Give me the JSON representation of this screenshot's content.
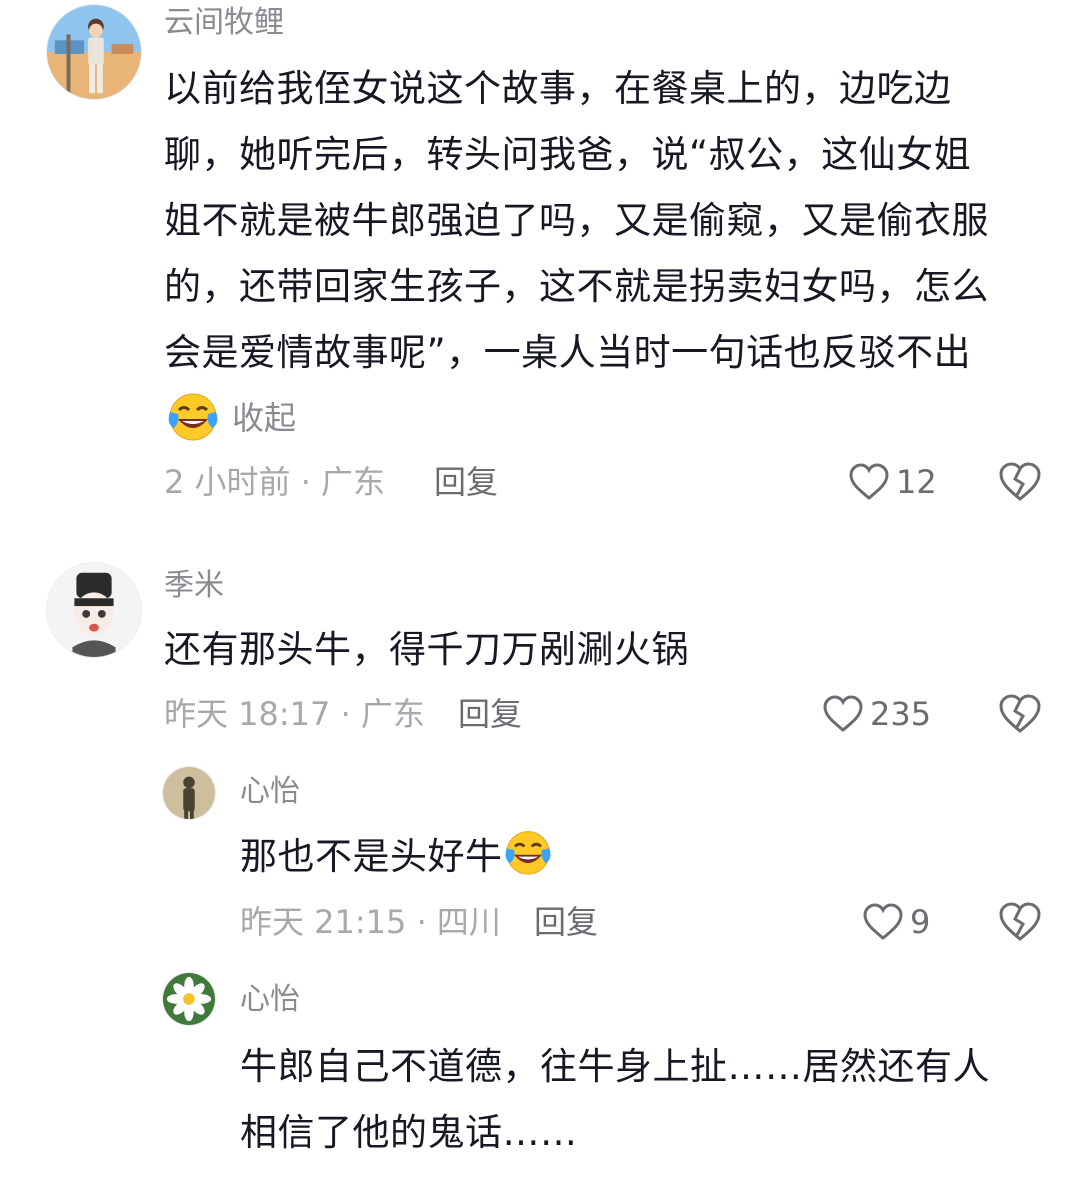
{
  "comments": [
    {
      "username": "云间牧鲤",
      "avatar_icon": "beach-person-avatar",
      "text_lines": [
        "以前给我侄女说这个故事，在餐桌上的，边吃边",
        "聊，她听完后，转头问我爸，说“叔公，这仙女姐",
        "姐不就是被牛郎强迫了吗，又是偷窥，又是偷衣服",
        "的，还带回家生孩子，这不就是拐卖妇女吗，怎么",
        "会是爱情故事呢”，一桌人当时一句话也反驳不出"
      ],
      "collapse_label": "收起",
      "meta": "2 小时前 · 广东",
      "reply_label": "回复",
      "likes": "12"
    },
    {
      "username": "季米",
      "avatar_icon": "cartoon-boy-avatar",
      "text_lines": [
        "还有那头牛，得千刀万剐涮火锅"
      ],
      "meta": "昨天 18:17 · 广东",
      "reply_label": "回复",
      "likes": "235"
    },
    {
      "username": "心怡",
      "avatar_icon": "silhouette-avatar",
      "text_lines": [
        "那也不是头好牛"
      ],
      "meta": "昨天 21:15 · 四川",
      "reply_label": "回复",
      "likes": "9"
    },
    {
      "username": "心怡",
      "avatar_icon": "flower-avatar",
      "text_lines": [
        "牛郎自己不道德，往牛身上扯……居然还有人",
        "相信了他的鬼话……"
      ]
    }
  ],
  "icons": {
    "like": "heart-outline-icon",
    "dislike": "broken-heart-icon",
    "laugh_cry": "laughing-tears-emoji"
  }
}
